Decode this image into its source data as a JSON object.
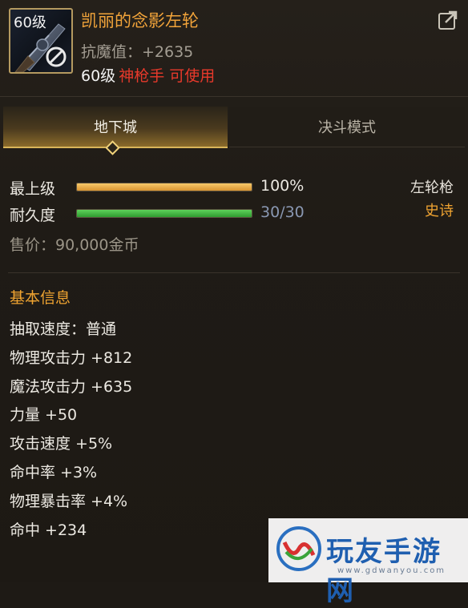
{
  "item": {
    "level_tag": "60级",
    "name": "凯丽的念影左轮",
    "resist": "抗魔值：+2635",
    "req_level": "60级",
    "req_class": "神枪手 可使用"
  },
  "tabs": [
    {
      "label": "地下城",
      "active": true
    },
    {
      "label": "决斗模式",
      "active": false
    }
  ],
  "status": {
    "upgrade": {
      "label": "最上级",
      "value_text": "100%",
      "fraction": 1.0,
      "color": "#e0a23a"
    },
    "durability": {
      "label": "耐久度",
      "value_text": "30/30",
      "fraction": 1.0,
      "color": "#3ab53a"
    },
    "weapon_type": "左轮枪",
    "rarity": "史诗",
    "rarity_color": "#f0a431",
    "price": "售价：90,000金币"
  },
  "basic_info": {
    "title": "基本信息",
    "attrs": [
      "抽取速度：普通",
      "物理攻击力 +812",
      "魔法攻击力 +635",
      "力量 +50",
      "攻击速度 +5%",
      "命中率 +3%",
      "物理暴击率 +4%",
      "命中 +234"
    ]
  },
  "watermark": {
    "text": "玩友手游网",
    "url": "www.gdwanyou.com"
  },
  "icons": {
    "share": "share-icon",
    "no_trade": "no-trade-icon",
    "weapon": "revolver-icon",
    "logo": "watermark-logo-icon"
  }
}
